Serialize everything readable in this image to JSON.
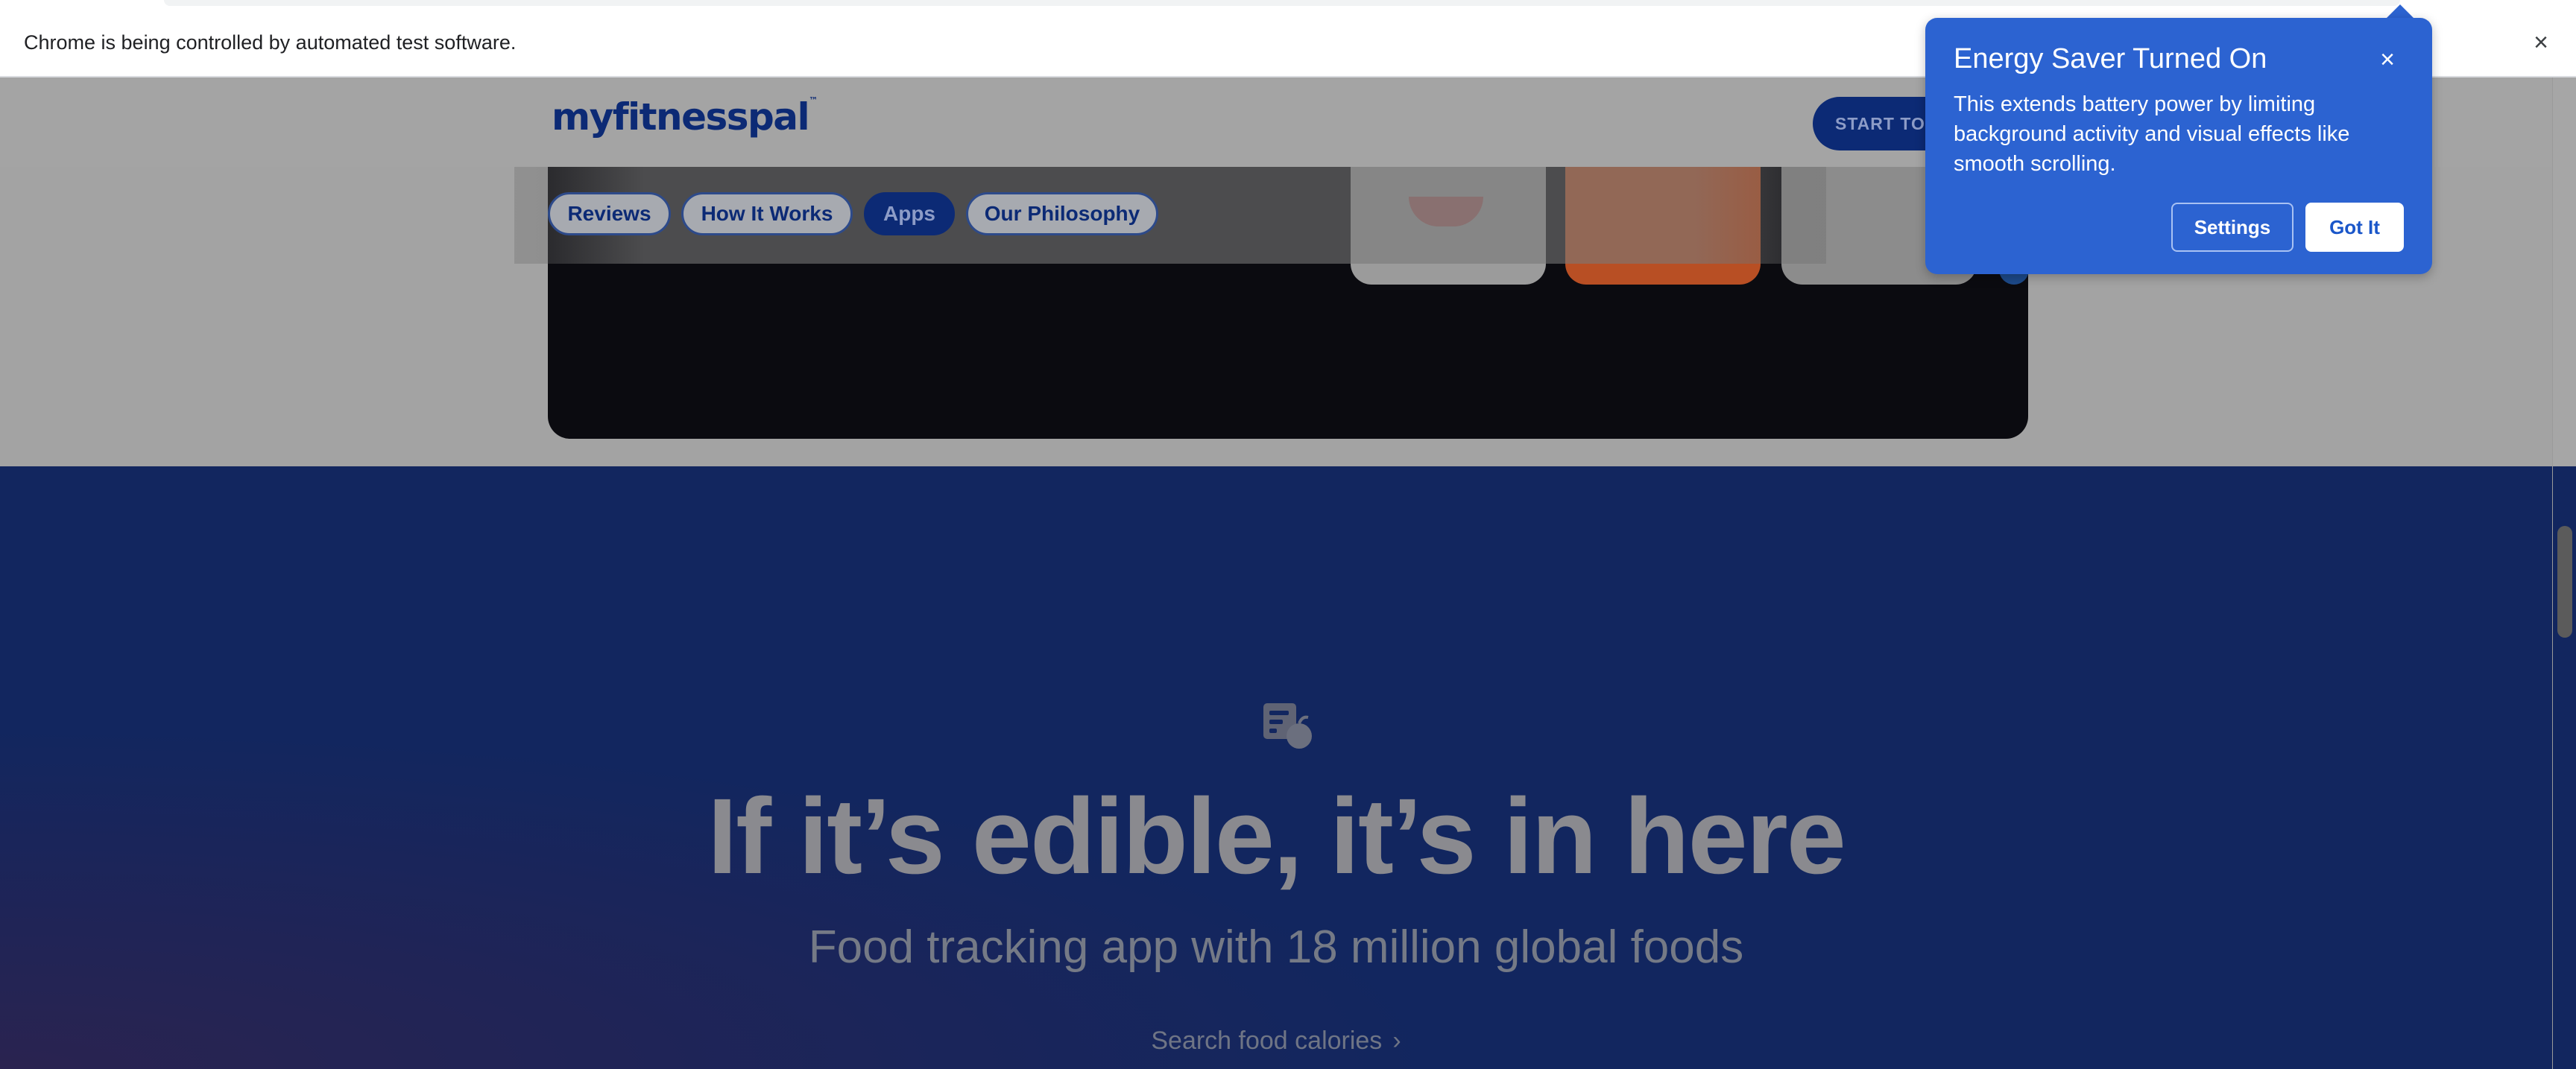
{
  "infobar": {
    "message": "Chrome is being controlled by automated test software.",
    "close_icon": "close-icon"
  },
  "header": {
    "logo": "myfitnesspal",
    "logo_mark": "™",
    "start_button": "START TO"
  },
  "subnav": {
    "items": [
      {
        "label": "Reviews",
        "active": false
      },
      {
        "label": "How It Works",
        "active": false
      },
      {
        "label": "Apps",
        "active": true
      },
      {
        "label": "Our Philosophy",
        "active": false
      }
    ]
  },
  "hero": {
    "icon": "food-log-icon",
    "title": "If it’s edible, it’s in here",
    "subtitle": "Food tracking app with 18 million global foods",
    "link_label": "Search food calories",
    "link_icon": "chevron-right-icon"
  },
  "energy_saver": {
    "title": "Energy Saver Turned On",
    "body": "This extends battery power by limiting background activity and visual effects like smooth scrolling.",
    "settings_label": "Settings",
    "got_it_label": "Got It",
    "close_icon": "close-icon"
  },
  "colors": {
    "brand_blue": "#0c2a75",
    "hero_bg": "#12265f",
    "bubble_bg": "#2c63d1"
  }
}
